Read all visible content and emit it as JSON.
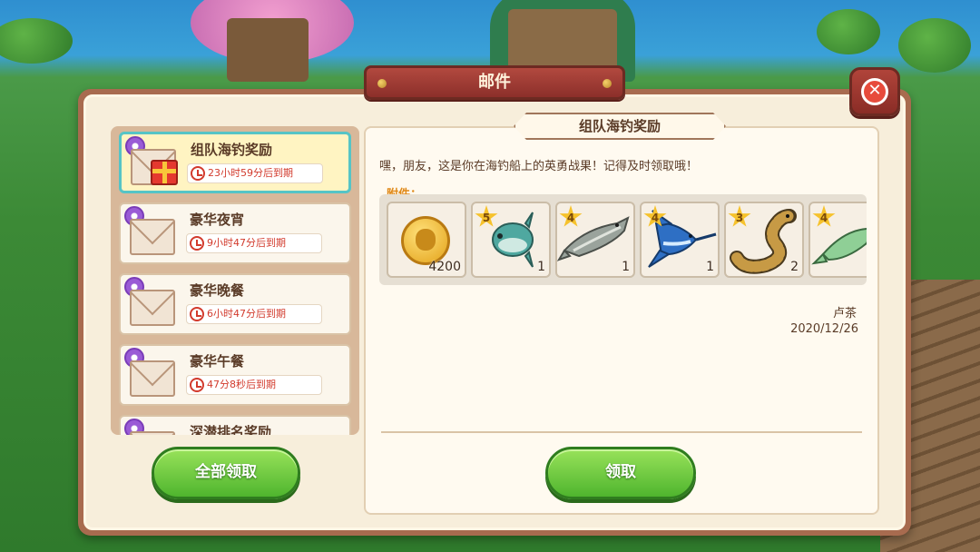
{
  "window_title": "邮件",
  "close_icon": "close-icon",
  "mail_list": [
    {
      "title": "组队海钓奖励",
      "expiry": "23小时59分后到期",
      "active": true,
      "has_gift": true
    },
    {
      "title": "豪华夜宵",
      "expiry": "9小时47分后到期"
    },
    {
      "title": "豪华晚餐",
      "expiry": "6小时47分后到期"
    },
    {
      "title": "豪华午餐",
      "expiry": "47分8秒后到期"
    },
    {
      "title": "深潜排名奖励",
      "expiry": ""
    }
  ],
  "detail": {
    "title": "组队海钓奖励",
    "message": "嘿，朋友，这是你在海钓船上的英勇战果！记得及时领取哦！",
    "attachments_label": "附件：",
    "attachments": [
      {
        "icon": "gold-coin-icon",
        "star": "",
        "qty": "4200"
      },
      {
        "icon": "sunfish-icon",
        "star": "5",
        "qty": "1"
      },
      {
        "icon": "sturgeon-icon",
        "star": "4",
        "qty": "1"
      },
      {
        "icon": "marlin-icon",
        "star": "4",
        "qty": "1"
      },
      {
        "icon": "moray-eel-icon",
        "star": "3",
        "qty": "2"
      },
      {
        "icon": "green-fish-icon",
        "star": "4",
        "qty": ""
      }
    ],
    "sender": "卢茶",
    "date": "2020/12/26"
  },
  "buttons": {
    "claim_all": "全部领取",
    "claim": "领取"
  },
  "colors": {
    "accent_green": "#4fb52e",
    "title_red": "#8c2f2a",
    "expiry_red": "#d23a2c"
  }
}
